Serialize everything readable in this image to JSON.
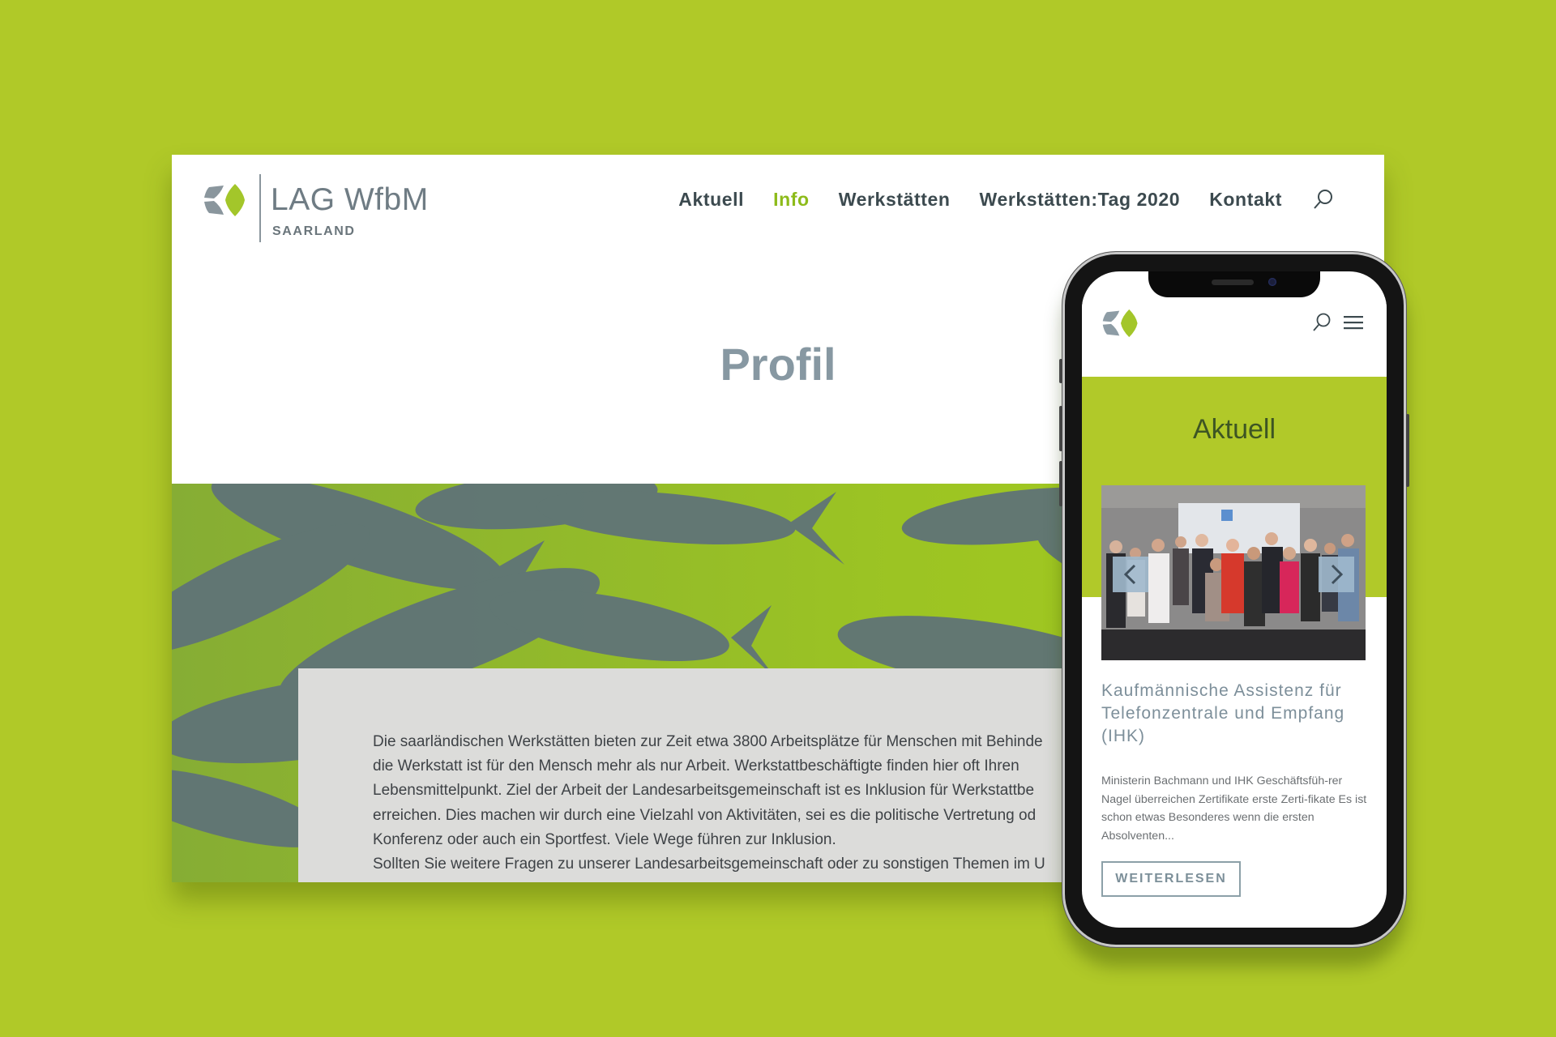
{
  "desktop": {
    "logo": {
      "title": "LAG WfbM",
      "subtitle": "SAARLAND",
      "icon": "lag-wfbm-logo-icon"
    },
    "nav": {
      "items": [
        {
          "label": "Aktuell",
          "active": false
        },
        {
          "label": "Info",
          "active": true
        },
        {
          "label": "Werkstätten",
          "active": false
        },
        {
          "label": "Werkstätten:Tag 2020",
          "active": false
        },
        {
          "label": "Kontakt",
          "active": false
        }
      ],
      "search_icon": "search-icon"
    },
    "page_title": "Profil",
    "hero_image": "fish-swarm-image",
    "content": {
      "lines": [
        "Die saarländischen Werkstätten bieten zur Zeit etwa 3800 Arbeitsplätze für Menschen mit Behinde",
        "die Werkstatt ist für den Mensch mehr als nur Arbeit. Werkstattbeschäftigte finden hier oft Ihren",
        "Lebensmittelpunkt. Ziel der Arbeit der Landesarbeitsgemeinschaft ist es Inklusion für Werkstattbe",
        "erreichen. Dies machen wir durch eine Vielzahl von Aktivitäten, sei es die politische Vertretung od",
        "Konferenz oder auch ein Sportfest. Viele Wege führen zur Inklusion.",
        "Sollten Sie weitere Fragen zu unserer Landesarbeitsgemeinschaft oder zu sonstigen Themen im U"
      ]
    }
  },
  "mobile": {
    "header": {
      "logo_icon": "lag-wfbm-logo-icon",
      "search_icon": "search-icon",
      "menu_icon": "hamburger-menu-icon"
    },
    "section_title": "Aktuell",
    "slider": {
      "image": "certificate-ceremony-group-photo",
      "prev_icon": "chevron-left-icon",
      "next_icon": "chevron-right-icon"
    },
    "post": {
      "title": "Kaufmännische Assistenz für Telefonzentrale und Empfang (IHK)",
      "excerpt": "Ministerin Bachmann und IHK Geschäftsfüh-rer Nagel überreichen Zertifikate erste Zerti-fikate   Es ist schon etwas Besonderes wenn die ersten Absolventen...",
      "button_label": "WEITERLESEN"
    }
  },
  "colors": {
    "background": "#b0c928",
    "accent_green": "#8dbb1a",
    "logo_grey": "#8a969d",
    "title_grey": "#8798a2",
    "nav_text": "#3c4a4f"
  }
}
